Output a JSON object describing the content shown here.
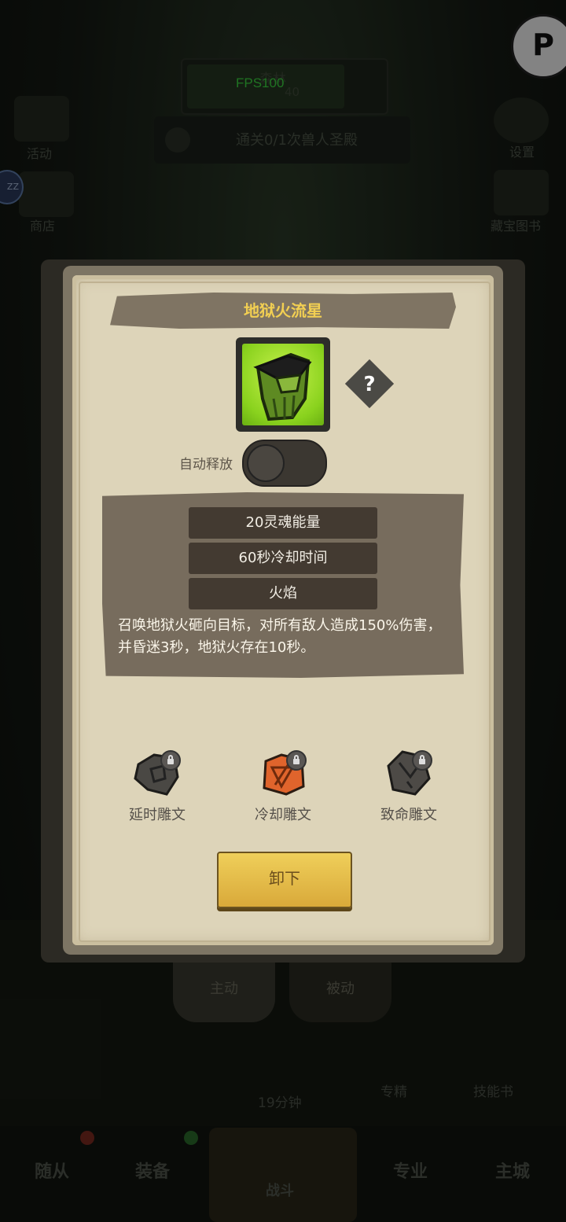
{
  "hud": {
    "fps": "FPS100",
    "map_title": "森林",
    "map_level": "40",
    "quest": "通关0/1次兽人圣殿",
    "left_icons": [
      "活动",
      "商店"
    ],
    "right_icons": [
      "设置",
      "藏宝图书"
    ],
    "corner_icon": "P"
  },
  "dialog": {
    "title": "地狱火流星",
    "skill_icon": "hellfire-meteor-icon",
    "help_symbol": "?",
    "auto_cast_label": "自动释放",
    "auto_cast_on": false,
    "stats": [
      "20灵魂能量",
      "60秒冷却时间",
      "火焰"
    ],
    "description": "召唤地狱火砸向目标，对所有敌人造成150%伤害，并昏迷3秒，地狱火存在10秒。",
    "runes": [
      {
        "label": "延时雕文",
        "icon": "delay-rune-icon",
        "locked": true
      },
      {
        "label": "冷却雕文",
        "icon": "cooldown-rune-icon",
        "locked": true
      },
      {
        "label": "致命雕文",
        "icon": "lethal-rune-icon",
        "locked": true
      }
    ],
    "unequip_label": "卸下"
  },
  "bottom": {
    "tabs": [
      "主动",
      "被动"
    ],
    "timer": "19分钟",
    "items": [
      "专精",
      "技能书"
    ],
    "nav": [
      "随从",
      "装备",
      "战斗",
      "专业",
      "主城"
    ]
  }
}
